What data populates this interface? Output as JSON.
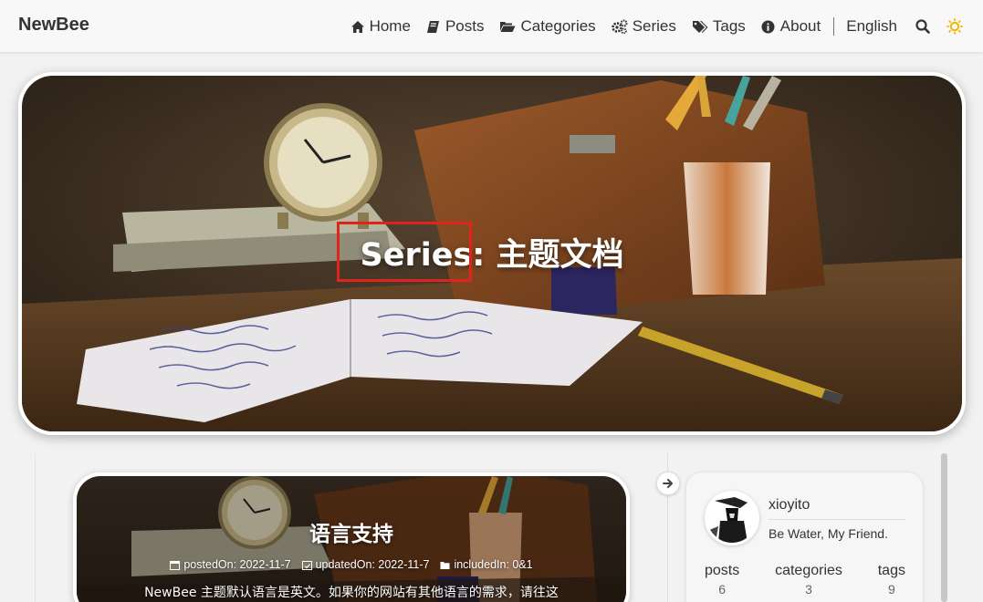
{
  "header": {
    "brand": "NewBee",
    "nav": [
      {
        "label": "Home",
        "icon": "home-icon"
      },
      {
        "label": "Posts",
        "icon": "book-icon"
      },
      {
        "label": "Categories",
        "icon": "folder-open-icon"
      },
      {
        "label": "Series",
        "icon": "cogs-icon"
      },
      {
        "label": "Tags",
        "icon": "tags-icon"
      },
      {
        "label": "About",
        "icon": "info-circle-icon"
      }
    ],
    "language": "English",
    "icons": {
      "search": "search-icon",
      "theme": "sun-icon"
    },
    "theme_color": "#f4b400"
  },
  "hero": {
    "title": "Series: 主题文档",
    "highlight_color": "#e0241d"
  },
  "post": {
    "title": "语言支持",
    "posted_on": "postedOn: 2022-11-7",
    "updated_on": "updatedOn: 2022-11-7",
    "included_in": "includedIn: 0&1",
    "excerpt": "NewBee 主题默认语言是英文。如果你的网站有其他语言的需求，请往这"
  },
  "sidebar": {
    "author": "xioyito",
    "motto": "Be Water, My Friend.",
    "stats": [
      {
        "label": "posts",
        "value": "6"
      },
      {
        "label": "categories",
        "value": "3"
      },
      {
        "label": "tags",
        "value": "9"
      }
    ]
  }
}
